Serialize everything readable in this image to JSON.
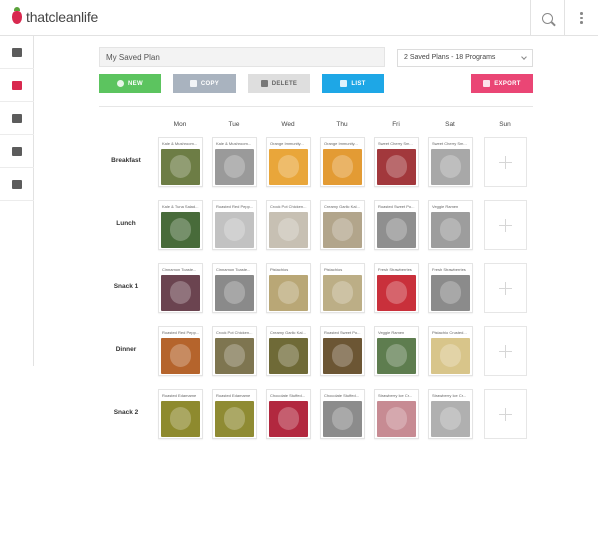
{
  "header": {
    "brand": "thatcleanlife",
    "search_icon": "search-icon",
    "menu_icon": "kebab-menu-icon"
  },
  "sidebar": {
    "items": [
      {
        "icon": "inbox-icon",
        "active": false
      },
      {
        "icon": "calendar-icon",
        "active": true
      },
      {
        "icon": "documents-icon",
        "active": false
      },
      {
        "icon": "list-icon",
        "active": false
      },
      {
        "icon": "archive-icon",
        "active": false
      }
    ]
  },
  "toolbar": {
    "plan_name": "My Saved Plan",
    "plan_select": "2 Saved Plans - 18 Programs",
    "new_label": "NEW",
    "copy_label": "COPY",
    "delete_label": "DELETE",
    "list_label": "LIST",
    "export_label": "EXPORT"
  },
  "colors": {
    "accent": "#d8294f",
    "new": "#5cc45f",
    "copy": "#a9b3bf",
    "list": "#1ea7e6",
    "export": "#ea4675"
  },
  "days": [
    "Mon",
    "Tue",
    "Wed",
    "Thu",
    "Fri",
    "Sat",
    "Sun"
  ],
  "meals": [
    {
      "label": "Breakfast",
      "cards": [
        {
          "title": "Kale & Mushroom...",
          "color": "#6d7d45"
        },
        {
          "title": "Kale & Mushroom...",
          "color": "#9a9a9a"
        },
        {
          "title": "Orange Immunity...",
          "color": "#e9a63a"
        },
        {
          "title": "Orange Immunity...",
          "color": "#e39b34"
        },
        {
          "title": "Sweet Cherry Sm...",
          "color": "#a2383c"
        },
        {
          "title": "Sweet Cherry Sm...",
          "color": "#a8a8a8"
        }
      ]
    },
    {
      "label": "Lunch",
      "cards": [
        {
          "title": "Kale & Tuna Salad...",
          "color": "#486b3a"
        },
        {
          "title": "Roasted Red Pepp...",
          "color": "#c2c2c2"
        },
        {
          "title": "Crock Pot Chicken...",
          "color": "#c7c0b3"
        },
        {
          "title": "Creamy Garlic Kal...",
          "color": "#b2a58b"
        },
        {
          "title": "Roasted Sweet Po...",
          "color": "#8f8f8f"
        },
        {
          "title": "Veggie Ramen",
          "color": "#9d9d9d"
        }
      ]
    },
    {
      "label": "Snack 1",
      "cards": [
        {
          "title": "Cinnamon Toaste...",
          "color": "#6b4450"
        },
        {
          "title": "Cinnamon Toaste...",
          "color": "#8a8a8a"
        },
        {
          "title": "Pistachios",
          "color": "#b9a776"
        },
        {
          "title": "Pistachios",
          "color": "#bcae86"
        },
        {
          "title": "Fresh Strawberries",
          "color": "#c9303b"
        },
        {
          "title": "Fresh Strawberries",
          "color": "#8b8b8b"
        }
      ]
    },
    {
      "label": "Dinner",
      "cards": [
        {
          "title": "Roasted Red Pepp...",
          "color": "#b5642c"
        },
        {
          "title": "Crock Pot Chicken...",
          "color": "#7e7550"
        },
        {
          "title": "Creamy Garlic Kal...",
          "color": "#6f6a37"
        },
        {
          "title": "Roasted Sweet Po...",
          "color": "#6c5634"
        },
        {
          "title": "Veggie Ramen",
          "color": "#5e7d4f"
        },
        {
          "title": "Pistachio Crusted...",
          "color": "#d8c58a"
        }
      ]
    },
    {
      "label": "Snack 2",
      "cards": [
        {
          "title": "Roasted Edamame",
          "color": "#8e8a2e"
        },
        {
          "title": "Roasted Edamame",
          "color": "#8f8b33"
        },
        {
          "title": "Chocolate Stuffed...",
          "color": "#b2283f"
        },
        {
          "title": "Chocolate Stuffed...",
          "color": "#8c8c8c"
        },
        {
          "title": "Strawberry Ice Cr...",
          "color": "#c78b93"
        },
        {
          "title": "Strawberry Ice Cr...",
          "color": "#b0b0b0"
        }
      ]
    }
  ]
}
